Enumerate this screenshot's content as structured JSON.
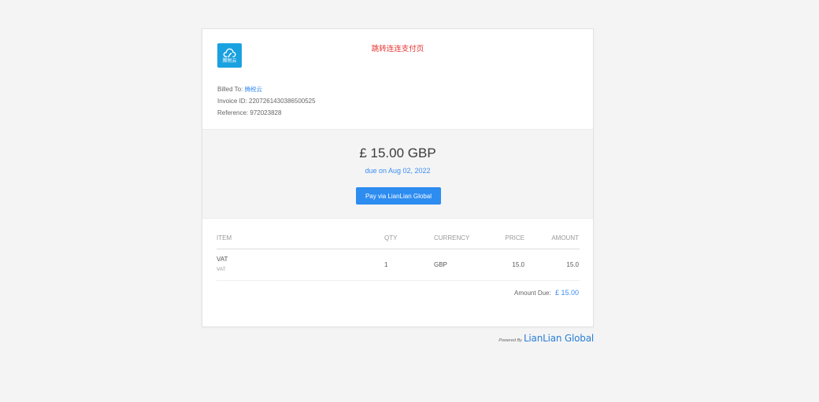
{
  "header": {
    "logo_text": "腾税云",
    "notice": "跳转连连支付页"
  },
  "billing": {
    "billed_to_label": "Billed To:",
    "billed_to_value": "腾税云",
    "invoice_id_label": "Invoice ID:",
    "invoice_id_value": "2207261430386500525",
    "reference_label": "Reference:",
    "reference_value": "972023828"
  },
  "summary": {
    "amount": "£ 15.00 GBP",
    "due": "due on Aug 02, 2022",
    "pay_button": "Pay via LianLian Global"
  },
  "table": {
    "headers": {
      "item": "ITEM",
      "qty": "QTY",
      "currency": "CURRENCY",
      "price": "PRICE",
      "amount": "AMOUNT"
    },
    "rows": [
      {
        "item": "VAT",
        "description": "VAT",
        "qty": "1",
        "currency": "GBP",
        "price": "15.0",
        "amount": "15.0"
      }
    ],
    "amount_due_label": "Amount Due:",
    "amount_due_value": "£ 15.00"
  },
  "footer": {
    "powered_by": "Powered By",
    "brand": "LianLian Global"
  },
  "colors": {
    "accent": "#2d8cf0",
    "link": "#3c8ef0",
    "notice": "#e5322d",
    "logo_bg": "#1aa1e0"
  },
  "icons": {
    "logo": "cloud-icon"
  }
}
